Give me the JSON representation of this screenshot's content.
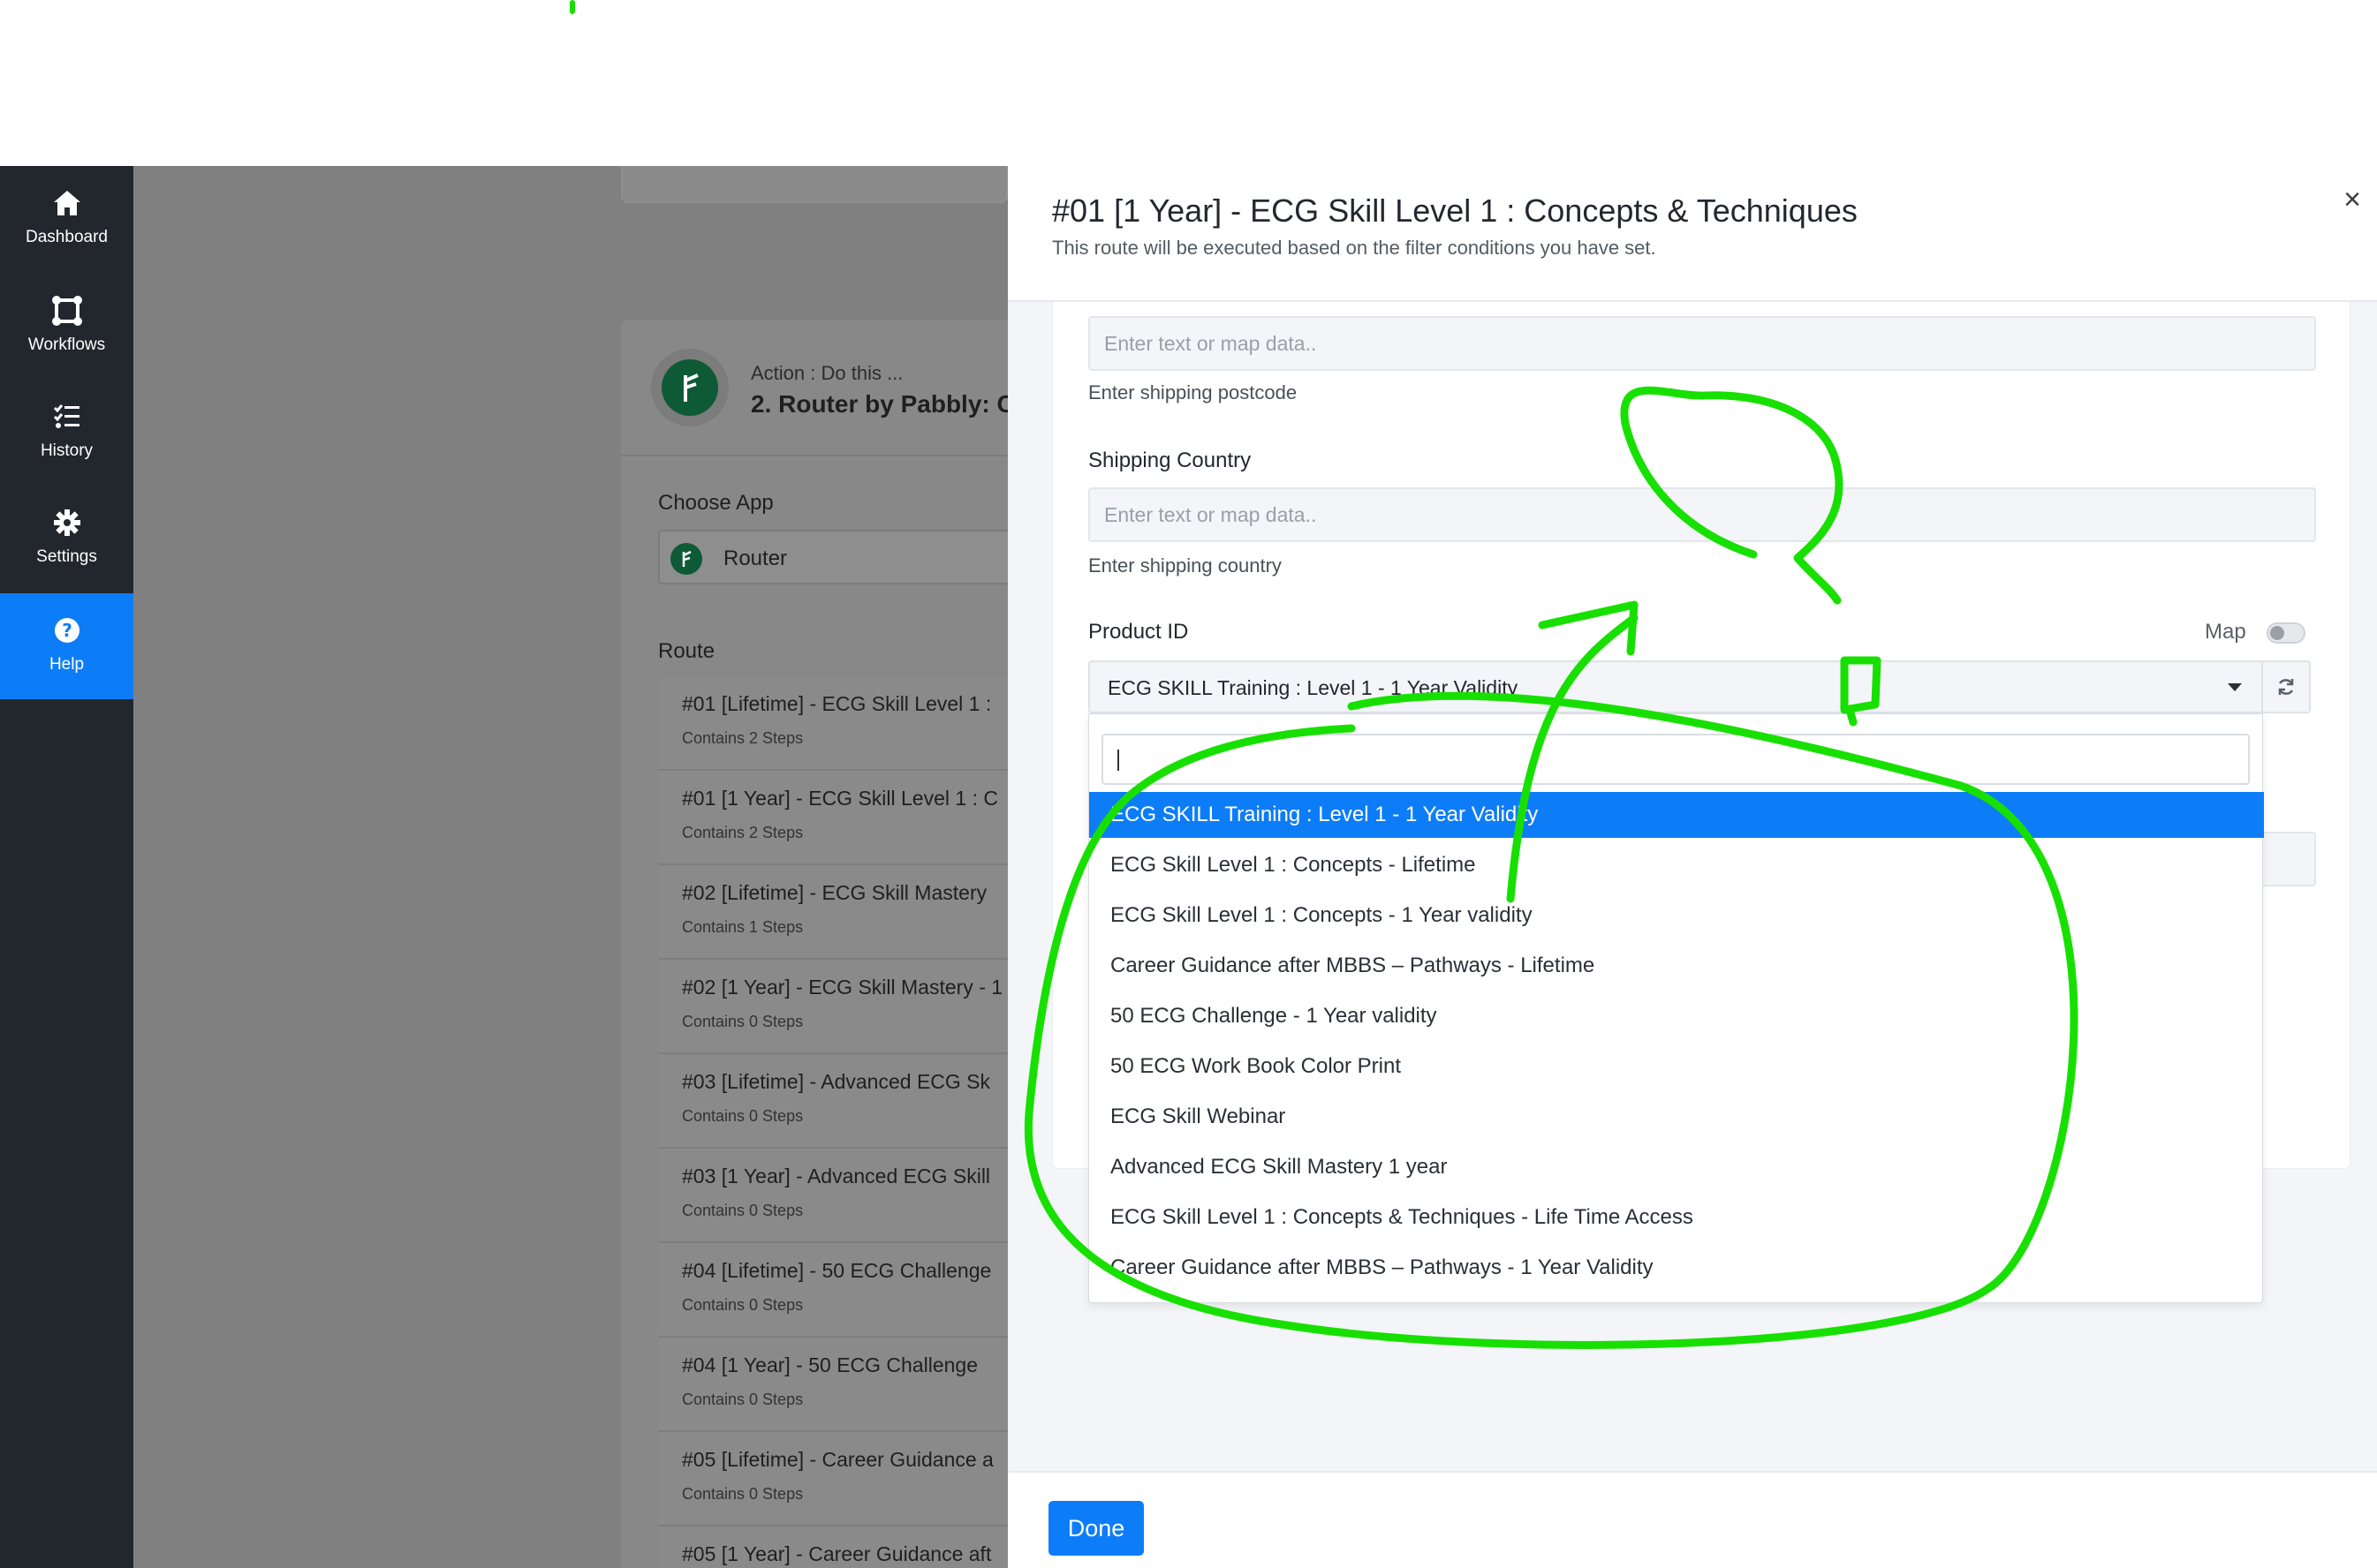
{
  "sidebar": {
    "items": [
      {
        "label": "Dashboard",
        "icon": "home-icon"
      },
      {
        "label": "Workflows",
        "icon": "workflows-icon"
      },
      {
        "label": "History",
        "icon": "history-list-icon"
      },
      {
        "label": "Settings",
        "icon": "gear-icon"
      },
      {
        "label": "Help",
        "icon": "help-circle-icon",
        "active": true
      }
    ]
  },
  "background": {
    "action_small": "Action : Do this ...",
    "action_title": "2. Router by Pabbly: C",
    "choose_app_label": "Choose App",
    "app_value": "Router",
    "route_label": "Route",
    "routes": [
      {
        "name": "#01 [Lifetime] - ECG Skill Level 1 :",
        "steps": "Contains 2 Steps"
      },
      {
        "name": "#01 [1 Year] - ECG Skill Level 1 : C",
        "steps": "Contains 2 Steps"
      },
      {
        "name": "#02 [Lifetime] - ECG Skill Mastery",
        "steps": "Contains 1 Steps"
      },
      {
        "name": "#02 [1 Year] - ECG Skill Mastery - 1",
        "steps": "Contains 0 Steps"
      },
      {
        "name": "#03 [Lifetime] - Advanced ECG Sk",
        "steps": "Contains 0 Steps"
      },
      {
        "name": "#03 [1 Year] - Advanced ECG Skill",
        "steps": "Contains 0 Steps"
      },
      {
        "name": "#04 [Lifetime] - 50 ECG Challenge",
        "steps": "Contains 0 Steps"
      },
      {
        "name": "#04 [1 Year] - 50 ECG Challenge",
        "steps": "Contains 0 Steps"
      },
      {
        "name": "#05 [Lifetime] - Career Guidance a",
        "steps": "Contains 0 Steps"
      },
      {
        "name": "#05 [1 Year] - Career Guidance aft",
        "steps": ""
      }
    ]
  },
  "modal": {
    "title": "#01 [1 Year] - ECG Skill Level 1 : Concepts & Techniques",
    "subtitle": "This route will be executed based on the filter conditions you have set.",
    "close": "×",
    "postcode_input_placeholder": "Enter text or map data..",
    "postcode_help": "Enter shipping postcode",
    "country_label": "Shipping Country",
    "country_input_placeholder": "Enter text or map data..",
    "country_help": "Enter shipping country",
    "product_label": "Product ID",
    "map_label": "Map",
    "product_selected": "ECG SKILL Training : Level 1 - 1 Year Validity",
    "done_label": "Done"
  },
  "dropdown": {
    "search_value": "",
    "options": [
      "ECG SKILL Training : Level 1 - 1 Year Validity",
      "ECG Skill Level 1 : Concepts - Lifetime",
      "ECG Skill Level 1 : Concepts - 1 Year validity",
      "Career Guidance after MBBS – Pathways - Lifetime",
      "50 ECG Challenge - 1 Year validity",
      "50 ECG Work Book Color Print",
      "ECG Skill Webinar",
      "Advanced ECG Skill Mastery 1 year",
      "ECG Skill Level 1 : Concepts & Techniques - Life Time Access",
      "Career Guidance after MBBS – Pathways - 1 Year Validity"
    ],
    "selected_index": 0
  },
  "colors": {
    "accent": "#0d7df7",
    "sidebar_bg": "#22262d",
    "annotation": "#17e000"
  }
}
